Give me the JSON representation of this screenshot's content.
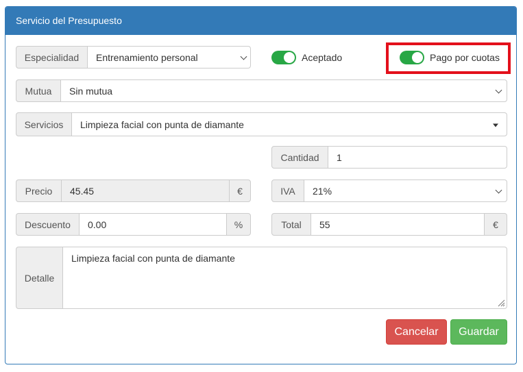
{
  "panel": {
    "title": "Servicio del Presupuesto"
  },
  "especialidad": {
    "label": "Especialidad",
    "value": "Entrenamiento personal"
  },
  "aceptado": {
    "label": "Aceptado",
    "on": true
  },
  "pago_cuotas": {
    "label": "Pago por cuotas",
    "on": true
  },
  "mutua": {
    "label": "Mutua",
    "value": "Sin mutua"
  },
  "servicios": {
    "label": "Servicios",
    "value": "Limpieza facial con punta de diamante"
  },
  "cantidad": {
    "label": "Cantidad",
    "value": "1"
  },
  "precio": {
    "label": "Precio",
    "value": "45.45",
    "unit": "€"
  },
  "iva": {
    "label": "IVA",
    "value": "21%"
  },
  "descuento": {
    "label": "Descuento",
    "value": "0.00",
    "unit": "%"
  },
  "total": {
    "label": "Total",
    "value": "55",
    "unit": "€"
  },
  "detalle": {
    "label": "Detalle",
    "value": "Limpieza facial con punta de diamante"
  },
  "buttons": {
    "cancel": "Cancelar",
    "save": "Guardar"
  },
  "colors": {
    "primary": "#337ab7",
    "toggle_on": "#28a745",
    "danger": "#d9534f",
    "success": "#5cb85c",
    "highlight": "#e3101b"
  }
}
